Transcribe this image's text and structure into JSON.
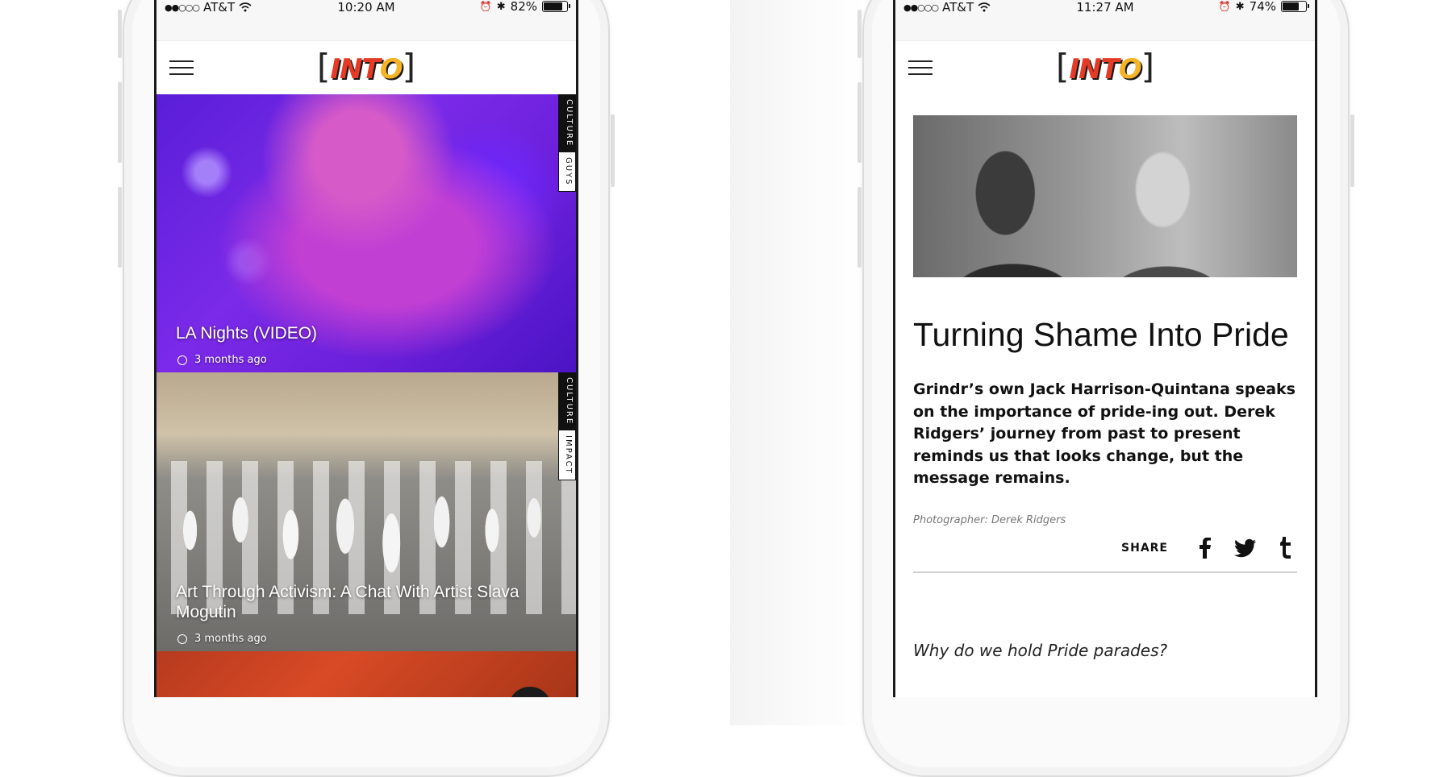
{
  "phone1": {
    "status": {
      "carrier": "AT&T",
      "time": "10:20 AM",
      "battery": "82%",
      "battery_level": 0.82
    },
    "logo": "INTO",
    "cards": [
      {
        "tags": [
          "CULTURE",
          "GUYS"
        ],
        "title": "LA Nights (VIDEO)",
        "time": "3 months ago"
      },
      {
        "tags": [
          "CULTURE",
          "IMPACT"
        ],
        "title": "Art Through Activism: A Chat With Artist Slava Mogutin",
        "time": "3 months ago"
      }
    ]
  },
  "phone2": {
    "status": {
      "carrier": "AT&T",
      "time": "11:27 AM",
      "battery": "74%",
      "battery_level": 0.74
    },
    "logo": "INTO",
    "article": {
      "title": "Turning Shame Into Pride",
      "lede": "Grindr’s own Jack Harrison-Quintana speaks on the importance of pride-ing out. Derek Ridgers’ journey from past to present reminds us that looks change, but the message remains.",
      "credit": "Photographer: Derek Ridgers",
      "share_label": "SHARE",
      "share_icons": [
        "facebook-icon",
        "twitter-icon",
        "tumblr-icon"
      ],
      "question": "Why do we hold Pride parades?"
    }
  },
  "colors": {
    "logo_red": "#e53a26",
    "logo_yellow": "#f7b326",
    "ink": "#111111"
  }
}
